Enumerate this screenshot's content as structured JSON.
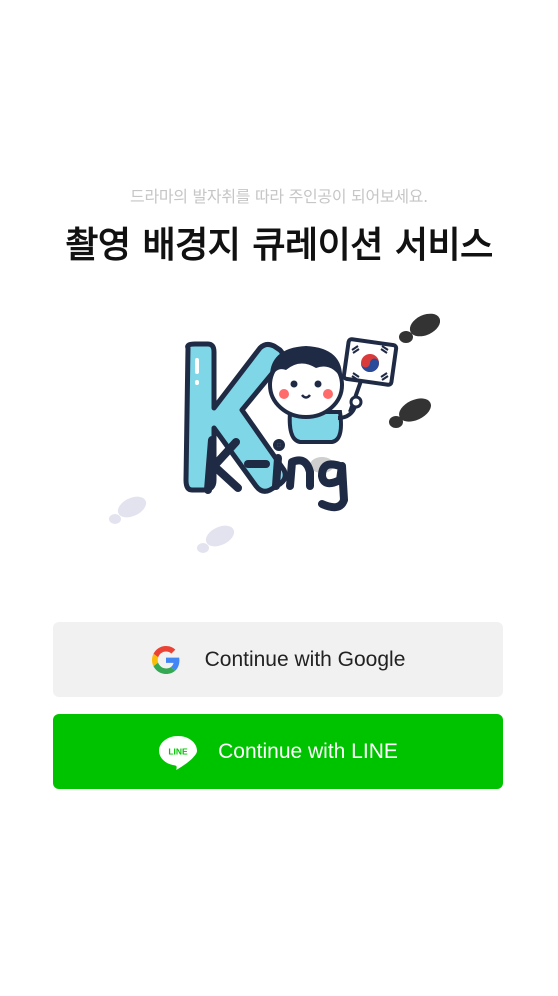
{
  "header": {
    "subtitle": "드라마의 발자취를 따라 주인공이 되어보세요.",
    "title": "촬영 배경지 큐레이션 서비스"
  },
  "logo": {
    "text": "K-ing",
    "icon": "k-ing-mascot-logo"
  },
  "auth": {
    "google": {
      "label": "Continue with Google",
      "icon": "google-icon"
    },
    "line": {
      "label": "Continue with LINE",
      "icon": "line-icon",
      "icon_text": "LINE"
    }
  },
  "colors": {
    "line_green": "#00c300",
    "google_button_bg": "#f1f1f1",
    "logo_blue": "#7fd6e6",
    "logo_navy": "#1f2a44"
  }
}
